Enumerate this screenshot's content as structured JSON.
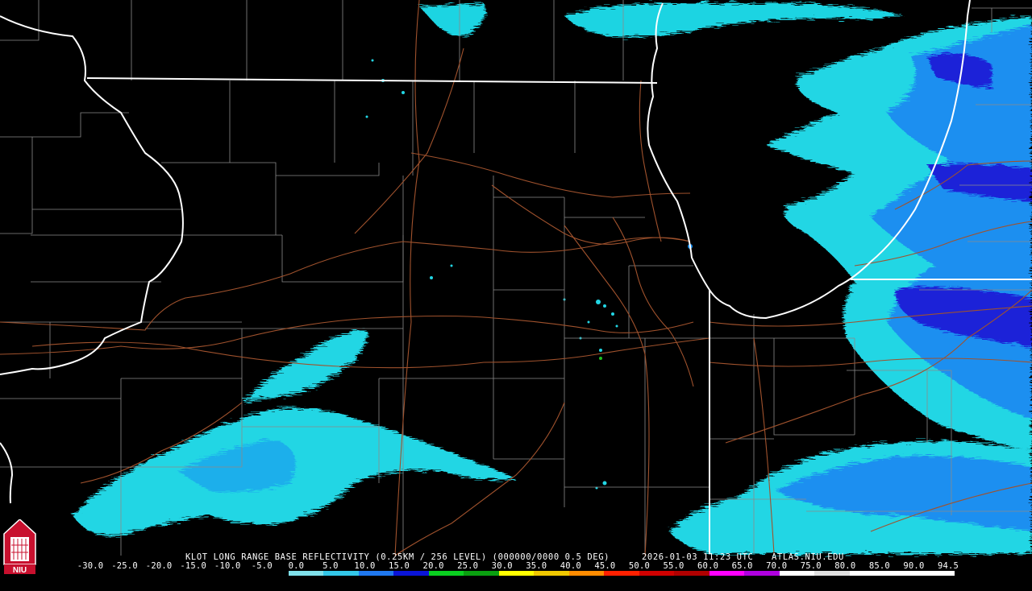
{
  "header": {
    "product_text": "KLOT LONG RANGE BASE REFLECTIVITY (0.25KM / 256 LEVEL) (000000/0000 0.5 DEG)",
    "datetime_text": "2026-01-03 11:23 UTC",
    "source_text": "ATLAS.NIU.EDU"
  },
  "logo": {
    "text": "NIU",
    "name": "niu-logo"
  },
  "colorbar": {
    "ticks": [
      "-30.0",
      "-25.0",
      "-20.0",
      "-15.0",
      "-10.0",
      "-5.0",
      "0.0",
      "5.0",
      "10.0",
      "15.0",
      "20.0",
      "25.0",
      "30.0",
      "35.0",
      "40.0",
      "45.0",
      "50.0",
      "55.0",
      "60.0",
      "65.0",
      "70.0",
      "75.0",
      "80.0",
      "85.0",
      "90.0",
      "94.5"
    ],
    "colors": [
      "#000000",
      "#000000",
      "#000000",
      "#000000",
      "#000000",
      "#000000",
      "#7fe0ea",
      "#33c7e8",
      "#1f78f0",
      "#0a14d8",
      "#0ad020",
      "#0aa010",
      "#ffff00",
      "#f0c800",
      "#ff8c00",
      "#ff2000",
      "#d00000",
      "#b00000",
      "#ff00ff",
      "#b000e0",
      "#ffffff",
      "#e0e0e0",
      "#ffffff",
      "#ffffff",
      "#ffffff"
    ],
    "units_note": ""
  },
  "colors": {
    "background": "#000000",
    "state_border": "#ffffff",
    "county_border": "#8a8a8a",
    "highway": "#a0522d",
    "echo_light": "#22dde6",
    "echo_medium": "#1a8ff0",
    "echo_strong": "#1a1ad8"
  }
}
